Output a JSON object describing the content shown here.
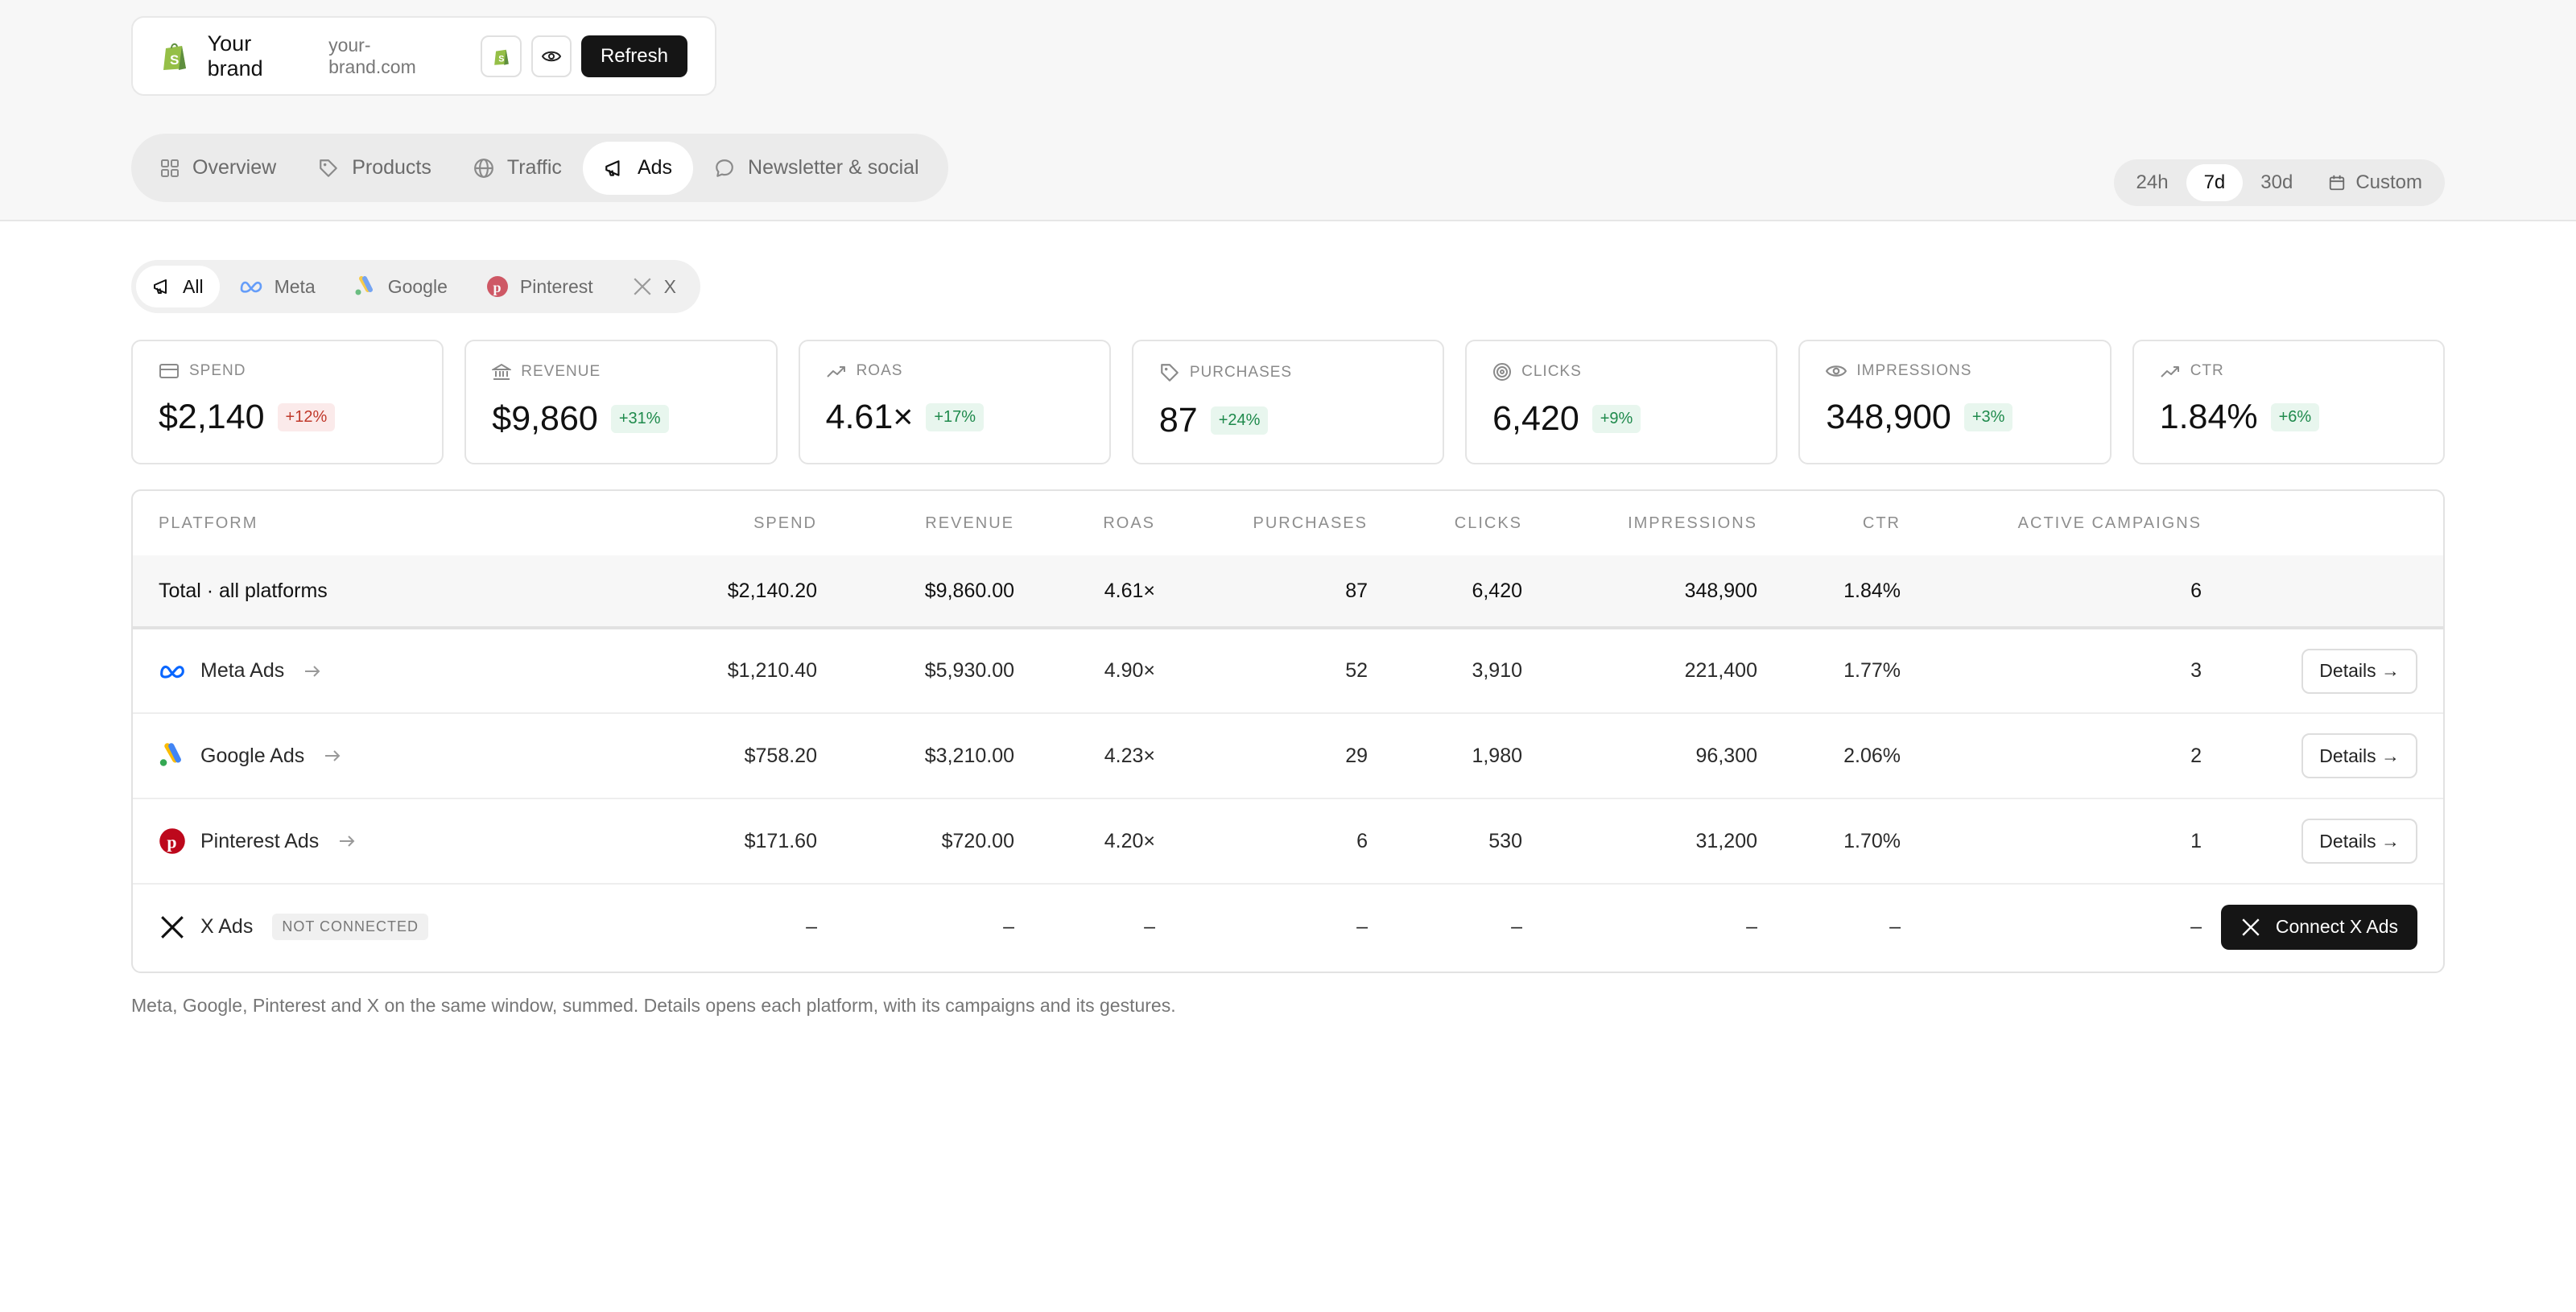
{
  "brand": {
    "name": "Your brand",
    "domain": "your-brand.com",
    "refresh_label": "Refresh"
  },
  "nav": {
    "tabs": [
      {
        "label": "Overview",
        "icon": "grid-icon"
      },
      {
        "label": "Products",
        "icon": "tag-icon"
      },
      {
        "label": "Traffic",
        "icon": "globe-icon"
      },
      {
        "label": "Ads",
        "icon": "megaphone-icon",
        "active": true
      },
      {
        "label": "Newsletter & social",
        "icon": "chat-icon"
      }
    ]
  },
  "timerange": {
    "options": [
      "24h",
      "7d",
      "30d",
      "Custom"
    ],
    "selected": "7d"
  },
  "platform_filter": {
    "options": [
      "All",
      "Meta",
      "Google",
      "Pinterest",
      "X"
    ],
    "selected": "All"
  },
  "kpis": [
    {
      "label": "SPEND",
      "value": "$2,140",
      "delta": "+12%",
      "trend": "down",
      "icon": "card-icon"
    },
    {
      "label": "REVENUE",
      "value": "$9,860",
      "delta": "+31%",
      "trend": "up",
      "icon": "bank-icon"
    },
    {
      "label": "ROAS",
      "value": "4.61×",
      "delta": "+17%",
      "trend": "up",
      "icon": "trending-up-icon"
    },
    {
      "label": "PURCHASES",
      "value": "87",
      "delta": "+24%",
      "trend": "up",
      "icon": "tag-icon"
    },
    {
      "label": "CLICKS",
      "value": "6,420",
      "delta": "+9%",
      "trend": "up",
      "icon": "target-icon"
    },
    {
      "label": "IMPRESSIONS",
      "value": "348,900",
      "delta": "+3%",
      "trend": "up",
      "icon": "eye-icon"
    },
    {
      "label": "CTR",
      "value": "1.84%",
      "delta": "+6%",
      "trend": "up",
      "icon": "trending-up-icon"
    }
  ],
  "table": {
    "headers": [
      "PLATFORM",
      "SPEND",
      "REVENUE",
      "ROAS",
      "PURCHASES",
      "CLICKS",
      "IMPRESSIONS",
      "CTR",
      "ACTIVE CAMPAIGNS"
    ],
    "total": {
      "label": "Total · all platforms",
      "spend": "$2,140.20",
      "revenue": "$9,860.00",
      "roas": "4.61×",
      "purchases": "87",
      "clicks": "6,420",
      "impressions": "348,900",
      "ctr": "1.84%",
      "active": "6"
    },
    "rows": [
      {
        "name": "Meta Ads",
        "spend": "$1,210.40",
        "revenue": "$5,930.00",
        "roas": "4.90×",
        "purchases": "52",
        "clicks": "3,910",
        "impressions": "221,400",
        "ctr": "1.77%",
        "active": "3",
        "action": "Details →"
      },
      {
        "name": "Google Ads",
        "spend": "$758.20",
        "revenue": "$3,210.00",
        "roas": "4.23×",
        "purchases": "29",
        "clicks": "1,980",
        "impressions": "96,300",
        "ctr": "2.06%",
        "active": "2",
        "action": "Details →"
      },
      {
        "name": "Pinterest Ads",
        "spend": "$171.60",
        "revenue": "$720.00",
        "roas": "4.20×",
        "purchases": "6",
        "clicks": "530",
        "impressions": "31,200",
        "ctr": "1.70%",
        "active": "1",
        "action": "Details →"
      },
      {
        "name": "X Ads",
        "badge": "NOT CONNECTED",
        "spend": "–",
        "revenue": "–",
        "roas": "–",
        "purchases": "–",
        "clicks": "–",
        "impressions": "–",
        "ctr": "–",
        "active": "–",
        "action": "Connect X Ads"
      }
    ]
  },
  "footnote": "Meta, Google, Pinterest and X on the same window, summed. Details opens each platform, with its campaigns and its gestures.",
  "colors": {
    "accent_dark": "#151515",
    "positive": "#1f8a4c",
    "negative": "#c0392b",
    "meta_blue": "#0866ff",
    "pinterest_red": "#bd081c",
    "shopify_green": "#95bf47"
  }
}
